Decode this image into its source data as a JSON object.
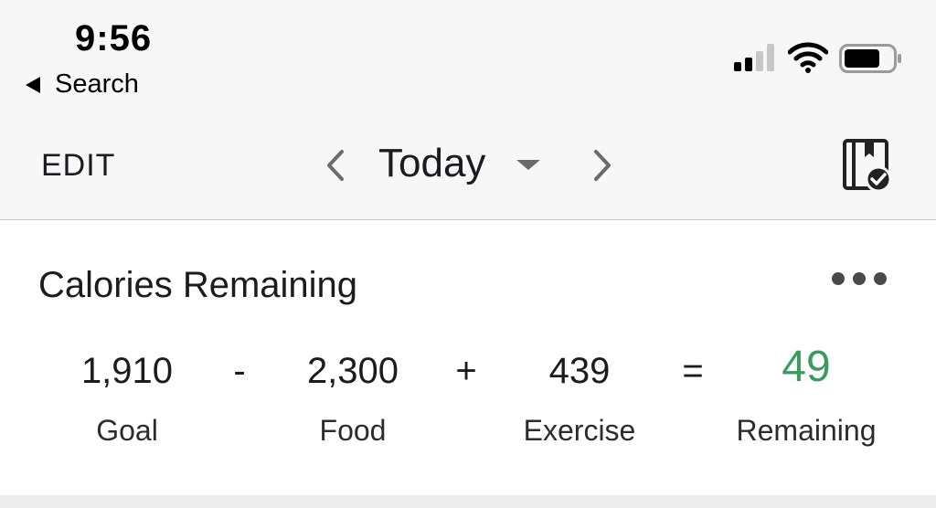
{
  "status_bar": {
    "time": "9:56",
    "back_label": "Search",
    "icons": [
      "cellular-signal-icon",
      "wifi-icon",
      "battery-icon"
    ]
  },
  "nav": {
    "edit_label": "EDIT",
    "date_label": "Today",
    "icons": {
      "prev": "chevron-left-icon",
      "dropdown": "caret-down-icon",
      "next": "chevron-right-icon",
      "diary": "diary-complete-icon"
    }
  },
  "calories": {
    "title": "Calories Remaining",
    "goal_value": "1,910",
    "goal_label": "Goal",
    "minus": "-",
    "food_value": "2,300",
    "food_label": "Food",
    "plus": "+",
    "exercise_value": "439",
    "exercise_label": "Exercise",
    "equals": "=",
    "remaining_value": "49",
    "remaining_label": "Remaining"
  },
  "colors": {
    "remaining_green": "#3c9a5f",
    "header_bg": "#f7f7f7",
    "divider": "#c8c8c8"
  }
}
